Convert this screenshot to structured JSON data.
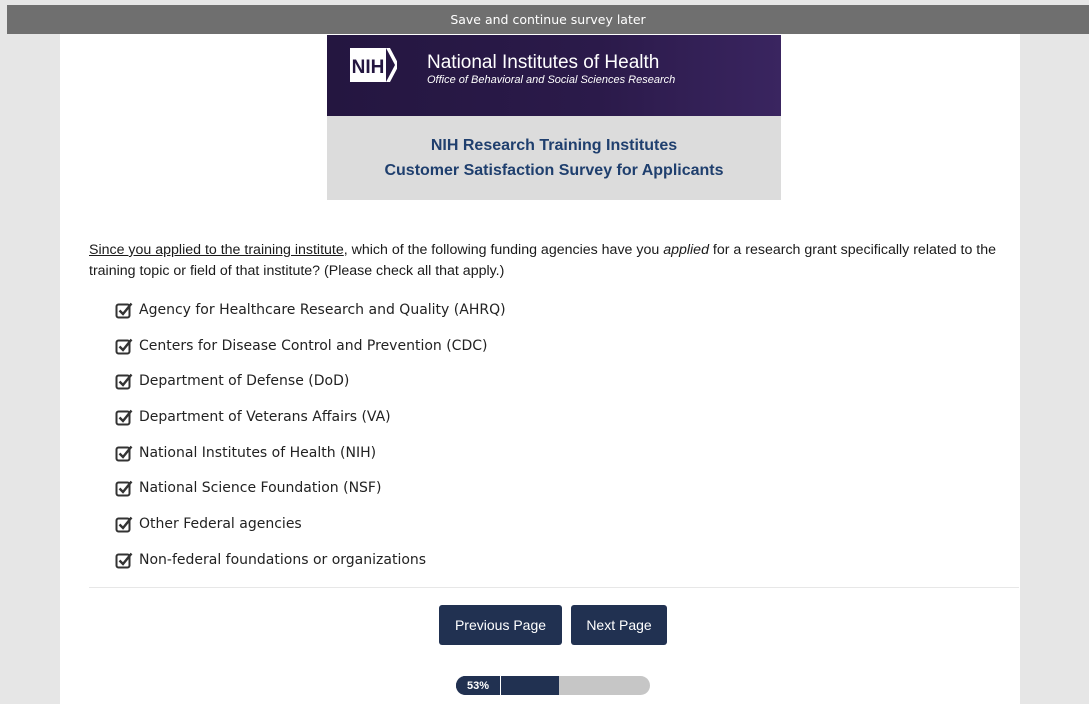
{
  "topbar": {
    "save_later": "Save and continue survey later"
  },
  "header": {
    "logo_mark": "NIH",
    "org_name": "National Institutes of Health",
    "office_name": "Office of Behavioral and Social Sciences Research",
    "survey_title_line1": "NIH Research Training Institutes",
    "survey_title_line2": "Customer Satisfaction Survey for Applicants"
  },
  "question": {
    "part1_underlined": "Since you applied to the training institute",
    "part2": ", which of the following funding agencies have you ",
    "part3_italic": "applied",
    "part4": " for a research grant specifically related to the training topic or field of that institute? (Please check all that apply.)"
  },
  "options": [
    {
      "label": "Agency for Healthcare Research and Quality (AHRQ)",
      "checked": true
    },
    {
      "label": "Centers for Disease Control and Prevention (CDC)",
      "checked": true
    },
    {
      "label": "Department of Defense (DoD)",
      "checked": true
    },
    {
      "label": "Department of Veterans Affairs (VA)",
      "checked": true
    },
    {
      "label": "National Institutes of Health (NIH)",
      "checked": true
    },
    {
      "label": "National Science Foundation (NSF)",
      "checked": true
    },
    {
      "label": "Other Federal agencies",
      "checked": true
    },
    {
      "label": "Non-federal foundations or organizations",
      "checked": true
    }
  ],
  "buttons": {
    "previous": "Previous Page",
    "next": "Next Page"
  },
  "progress": {
    "label": "53%",
    "value": 0.53
  },
  "colors": {
    "button_bg": "#213151",
    "header_band": "#241640",
    "title_text": "#1f3f6e",
    "topbar": "#6f6f6f"
  }
}
